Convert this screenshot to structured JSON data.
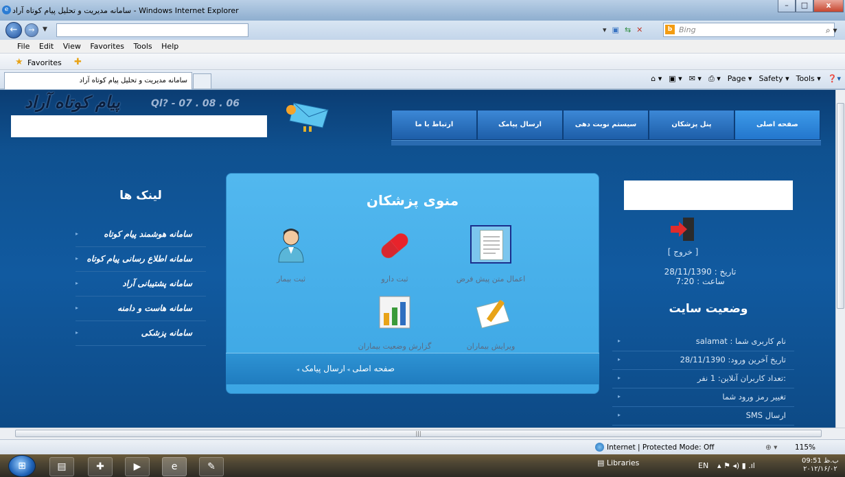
{
  "window": {
    "title": "سامانه مدیریت و تحلیل پیام کوتاه آراد - Windows Internet Explorer",
    "search_placeholder": "Bing"
  },
  "menubar": [
    "File",
    "Edit",
    "View",
    "Favorites",
    "Tools",
    "Help"
  ],
  "favorites": {
    "label": "Favorites"
  },
  "tab": {
    "title": "سامانه مدیریت و تحلیل پیام کوتاه آراد"
  },
  "commandbar": {
    "page": "Page ▾",
    "safety": "Safety ▾",
    "tools": "Tools ▾"
  },
  "site": {
    "logo": "پیام کوتاه آراد",
    "phone": "Ql&#63; - 07 . 08 . 06",
    "nav": [
      "صفحه اصلی",
      "پنل پزشکان",
      "سیستم نوبت دهی",
      "ارسال پیامک",
      "ارتباط با ما"
    ]
  },
  "links": {
    "title": "لینک ها",
    "items": [
      "سامانه هوشمند پیام کوتاه",
      "سامانه اطلاع رسانی پیام کوتاه",
      "سامانه پشتیبانی آراد",
      "سامانه هاست و دامنه",
      "سامانه پزشکی"
    ]
  },
  "panel": {
    "title": "منوی پزشکان",
    "items": [
      {
        "label": "ثبت بیمار",
        "icon": "doctor-icon"
      },
      {
        "label": "ثبت دارو",
        "icon": "pill-icon"
      },
      {
        "label": "اعمال متن پیش فرض",
        "icon": "document-icon"
      },
      {
        "label": "گزارش وضعیت بیماران",
        "icon": "report-chart-icon"
      },
      {
        "label": "ویرایش بیماران",
        "icon": "edit-icon"
      }
    ],
    "bottom_links": [
      "صفحه اصلی",
      "ارسال پیامک"
    ]
  },
  "user": {
    "exit": "[ خروج ]",
    "date": "تاریخ : 28/11/1390",
    "time": "ساعت : 7:20"
  },
  "status": {
    "title": "وضعیت سایت",
    "rows": [
      "نام کاربری شما : salamat",
      "تاریخ آخرین ورود: 28/11/1390",
      ":تعداد کاربران آنلاین: 1 نفر",
      "تغییر رمز ورود شما",
      "ارسال SMS"
    ]
  },
  "statusbar": {
    "zone": "Internet | Protected Mode: Off",
    "zoom": "115%"
  },
  "taskbar": {
    "libraries": "Libraries",
    "lang": "EN",
    "time": "09:51 ب.ظ",
    "date": "۲۰۱۲/۱۶/۰۲"
  }
}
